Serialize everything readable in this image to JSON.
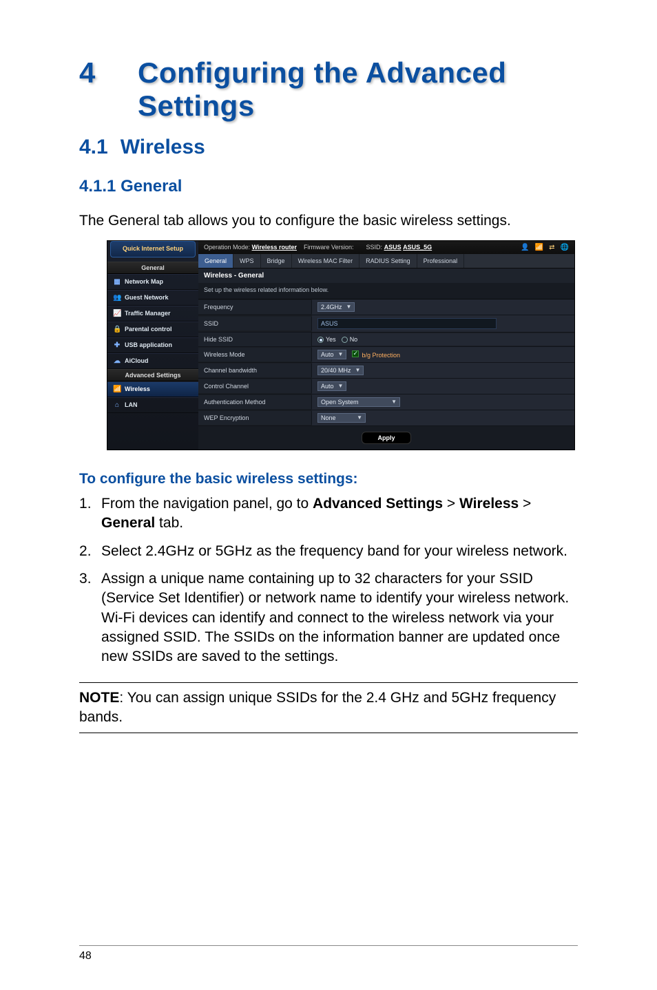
{
  "chapter": {
    "num": "4",
    "title": "Configuring the Advanced Settings"
  },
  "section": {
    "num": "4.1",
    "title": "Wireless"
  },
  "subsection": {
    "num": "4.1.1",
    "title": "General"
  },
  "intro": "The General tab allows you to configure the basic wireless settings.",
  "ui": {
    "top": {
      "op_mode_label": "Operation Mode:",
      "op_mode_value": "Wireless router",
      "fw_label": "Firmware Version:",
      "ssid_label": "SSID:",
      "ssid_value1": "ASUS",
      "ssid_value2": "ASUS_5G",
      "icons": {
        "user": "user-icon",
        "signal": "signal-icon",
        "usb": "usb-icon",
        "globe": "globe-icon"
      }
    },
    "sidebar": {
      "quick_internet_setup": "Quick Internet\nSetup",
      "general_heading": "General",
      "items_general": [
        {
          "icon": "map-icon",
          "label": "Network Map"
        },
        {
          "icon": "guest-icon",
          "label": "Guest Network"
        },
        {
          "icon": "traffic-icon",
          "label": "Traffic Manager"
        },
        {
          "icon": "lock-icon",
          "label": "Parental control"
        },
        {
          "icon": "usb-icon",
          "label": "USB application"
        },
        {
          "icon": "cloud-icon",
          "label": "AiCloud"
        }
      ],
      "adv_heading": "Advanced Settings",
      "items_adv": [
        {
          "icon": "wifi-icon",
          "label": "Wireless",
          "selected": true
        },
        {
          "icon": "home-icon",
          "label": "LAN",
          "selected": false
        }
      ]
    },
    "tabs": [
      "General",
      "WPS",
      "Bridge",
      "Wireless MAC Filter",
      "RADIUS Setting",
      "Professional"
    ],
    "active_tab": 0,
    "panel_title": "Wireless - General",
    "panel_sub": "Set up the wireless related information below.",
    "rows": {
      "frequency": {
        "label": "Frequency",
        "value": "2.4GHz"
      },
      "ssid": {
        "label": "SSID",
        "value": "ASUS"
      },
      "hide_ssid": {
        "label": "Hide SSID",
        "yes": "Yes",
        "no": "No",
        "selected": "Yes"
      },
      "wireless_mode": {
        "label": "Wireless Mode",
        "value": "Auto",
        "bg_protection": "b/g Protection"
      },
      "channel_bw": {
        "label": "Channel bandwidth",
        "value": "20/40 MHz"
      },
      "control_channel": {
        "label": "Control Channel",
        "value": "Auto"
      },
      "auth_method": {
        "label": "Authentication Method",
        "value": "Open System"
      },
      "wep": {
        "label": "WEP Encryption",
        "value": "None"
      }
    },
    "apply": "Apply"
  },
  "instructions": {
    "title": "To configure the basic wireless settings:",
    "steps": [
      {
        "pre": "From the navigation panel, go to ",
        "b1": "Advanced Settings",
        "mid1": " > ",
        "b2": "Wireless",
        "mid2": " > ",
        "b3": "General",
        "post": " tab."
      },
      {
        "text": "Select 2.4GHz or 5GHz as the frequency band for your wireless network."
      },
      {
        "text": "Assign a unique name containing up to 32 characters for your SSID (Service Set Identifier) or network name to identify your wireless network. Wi-Fi devices can identify and connect to the wireless network via your assigned SSID. The SSIDs on the information banner are updated once new SSIDs are saved to the settings."
      }
    ]
  },
  "note": {
    "label": "NOTE",
    "text": ":   You can assign unique SSIDs for the 2.4 GHz and 5GHz frequency bands."
  },
  "page_number": "48"
}
